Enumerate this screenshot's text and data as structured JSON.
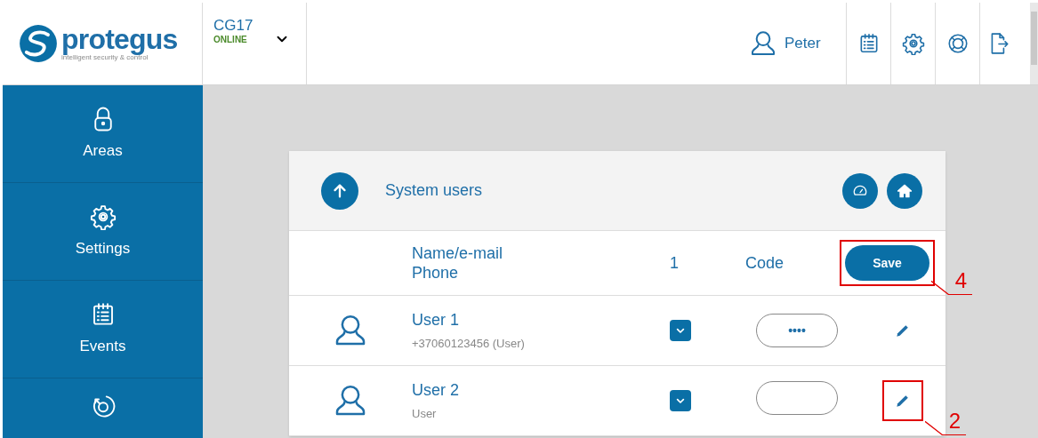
{
  "logo": {
    "name": "protegus",
    "tagline": "intelligent security & control"
  },
  "device": {
    "name": "CG17",
    "status": "ONLINE"
  },
  "header": {
    "user": "Peter"
  },
  "sidebar": {
    "items": [
      {
        "label": "Areas"
      },
      {
        "label": "Settings"
      },
      {
        "label": "Events"
      }
    ]
  },
  "panel": {
    "title": "System users",
    "columns": [
      "Name/e-mail\nPhone",
      "1",
      "Code"
    ],
    "save": "Save",
    "rows": [
      {
        "name": "User 1",
        "detail": "+37060123456 (User)",
        "code": "••••"
      },
      {
        "name": "User 2",
        "detail": "User"
      }
    ]
  },
  "callouts": [
    {
      "label": "4"
    },
    {
      "label": "2"
    }
  ]
}
